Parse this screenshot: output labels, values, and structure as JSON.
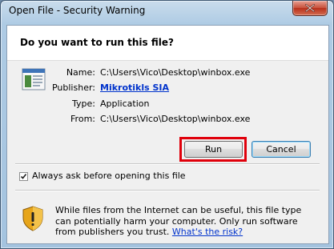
{
  "window": {
    "title": "Open File - Security Warning"
  },
  "dialog": {
    "question": "Do you want to run this file?",
    "fields": {
      "name": {
        "label": "Name:",
        "value": "C:\\Users\\Vico\\Desktop\\winbox.exe"
      },
      "publisher": {
        "label": "Publisher:",
        "value": "Mikrotikls SIA"
      },
      "type": {
        "label": "Type:",
        "value": "Application"
      },
      "from": {
        "label": "From:",
        "value": "C:\\Users\\Vico\\Desktop\\winbox.exe"
      }
    },
    "buttons": {
      "run": "Run",
      "cancel": "Cancel"
    },
    "checkbox": {
      "label": "Always ask before opening this file",
      "checked": true
    },
    "warning": {
      "text": "While files from the Internet can be useful, this file type can potentially harm your computer. Only run software from publishers you trust.",
      "link": "What's the risk?"
    }
  },
  "icons": {
    "close": "close-icon",
    "file": "application-file-icon",
    "shield": "warning-shield-icon",
    "check": "checkmark-icon"
  },
  "colors": {
    "highlight": "#e0000b",
    "link": "#0033cc"
  }
}
